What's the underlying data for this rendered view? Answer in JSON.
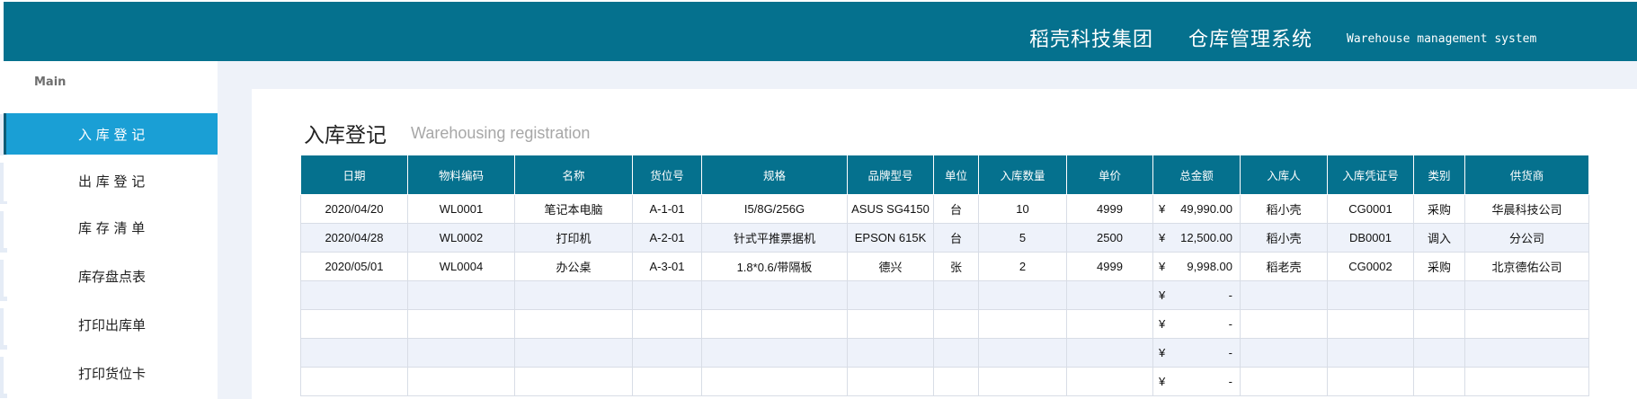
{
  "header": {
    "company": "稻壳科技集团",
    "system_name": "仓库管理系统",
    "system_name_en": "Warehouse management system",
    "bg_color": "#05718e"
  },
  "sidebar": {
    "section_label": "Main",
    "items": [
      {
        "label": "入 库  登 记",
        "active": true
      },
      {
        "label": "出 库  登 记",
        "active": false
      },
      {
        "label": "库 存  清 单",
        "active": false
      },
      {
        "label": "库存盘点表",
        "active": false
      },
      {
        "label": "打印出库单",
        "active": false
      },
      {
        "label": "打印货位卡",
        "active": false
      }
    ],
    "active_color": "#1a9fd5"
  },
  "main": {
    "title": "入库登记",
    "subtitle": "Warehousing registration",
    "table": {
      "columns": [
        "日期",
        "物料编码",
        "名称",
        "货位号",
        "规格",
        "品牌型号",
        "单位",
        "入库数量",
        "单价",
        "总金额",
        "入库人",
        "入库凭证号",
        "类别",
        "供货商"
      ],
      "rows": [
        [
          "2020/04/20",
          "WL0001",
          "笔记本电脑",
          "A-1-01",
          "I5/8G/256G",
          "ASUS SG4150",
          "台",
          "10",
          "4999",
          "49,990.00",
          "稻小壳",
          "CG0001",
          "采购",
          "华晨科技公司"
        ],
        [
          "2020/04/28",
          "WL0002",
          "打印机",
          "A-2-01",
          "针式平推票据机",
          "EPSON 615K",
          "台",
          "5",
          "2500",
          "12,500.00",
          "稻小壳",
          "DB0001",
          "调入",
          "分公司"
        ],
        [
          "2020/05/01",
          "WL0004",
          "办公桌",
          "A-3-01",
          "1.8*0.6/带隔板",
          "德兴",
          "张",
          "2",
          "4999",
          "9,998.00",
          "稻老壳",
          "CG0002",
          "采购",
          "北京德佑公司"
        ],
        [
          "",
          "",
          "",
          "",
          "",
          "",
          "",
          "",
          "",
          "-",
          "",
          "",
          "",
          ""
        ],
        [
          "",
          "",
          "",
          "",
          "",
          "",
          "",
          "",
          "",
          "-",
          "",
          "",
          "",
          ""
        ],
        [
          "",
          "",
          "",
          "",
          "",
          "",
          "",
          "",
          "",
          "-",
          "",
          "",
          "",
          ""
        ],
        [
          "",
          "",
          "",
          "",
          "",
          "",
          "",
          "",
          "",
          "-",
          "",
          "",
          "",
          ""
        ]
      ],
      "currency_symbol": "¥",
      "header_color": "#05718e"
    }
  }
}
